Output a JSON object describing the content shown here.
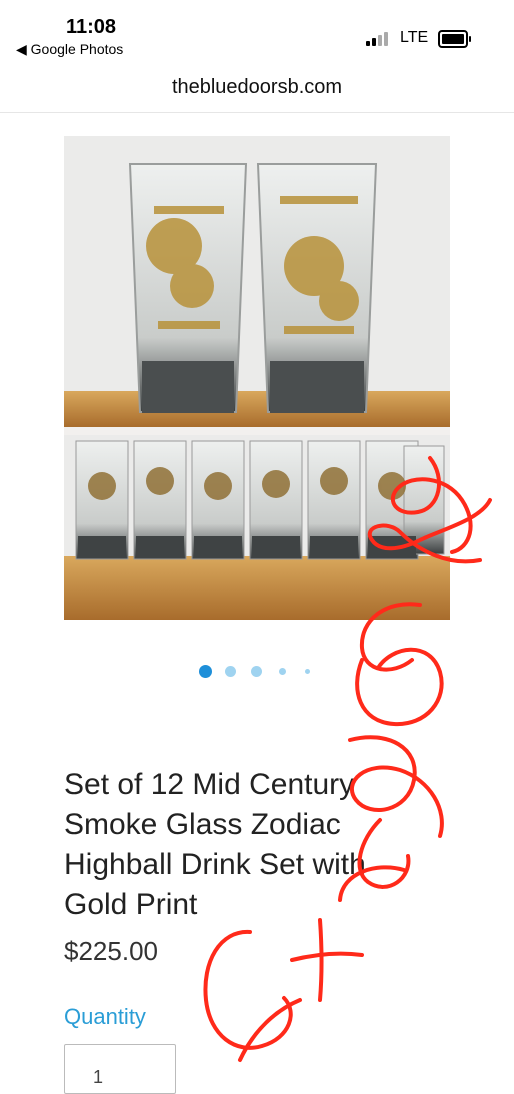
{
  "status_bar": {
    "time": "11:08",
    "back_app": "◀ Google Photos",
    "network": "LTE"
  },
  "browser": {
    "url": "thebluedoorsb.com"
  },
  "product": {
    "title": "Set of 12 Mid Century Smoke Glass Zodiac Highball Drink Set with Gold Print",
    "price": "$225.00",
    "quantity_label": "Quantity",
    "quantity_value": "1"
  },
  "gallery": {
    "image_count": 5,
    "active_index": 0
  },
  "colors": {
    "accent": "#2a9dd6",
    "active_dot": "#1e8fd9",
    "inactive_dot": "#9fd3f0",
    "annotation": "#ff2a1a"
  }
}
